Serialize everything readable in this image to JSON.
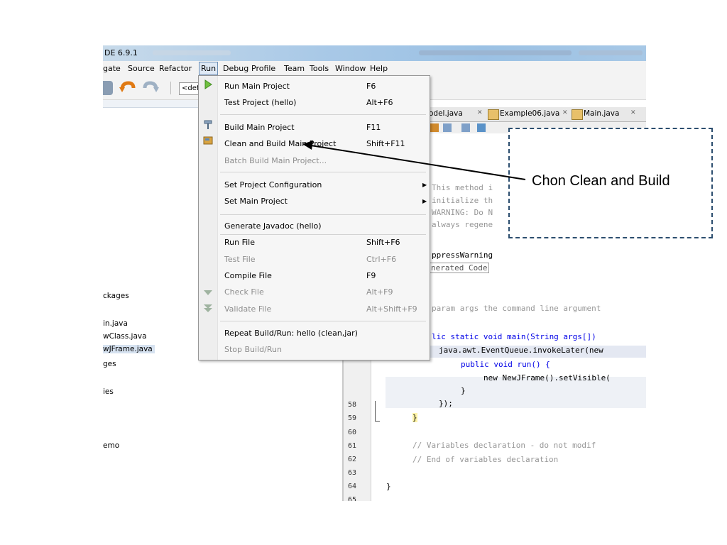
{
  "window": {
    "title": "DE 6.9.1"
  },
  "menubar": {
    "items": [
      "gate",
      "Source",
      "Refactor",
      "Run",
      "Debug",
      "Profile",
      "Team",
      "Tools",
      "Window",
      "Help"
    ]
  },
  "toolbar": {
    "config_combo": "<defa"
  },
  "project_panel": {
    "items": [
      "ckages",
      "in.java",
      "wClass.java",
      "wJFrame.java",
      "ges",
      "ies",
      "emo"
    ]
  },
  "editor": {
    "tabs": [
      "odel.java",
      "Example06.java",
      "Main.java"
    ],
    "line_numbers": [
      "58",
      "59",
      "60",
      "61",
      "62",
      "63",
      "64",
      "65"
    ],
    "code_lines": [
      "This method i",
      "initialize th",
      "WARNING: Do N",
      "always regene",
      "ppressWarning",
      "nerated Code",
      "param args the command line argument",
      "lic static void main(String args[])",
      "java.awt.EventQueue.invokeLater(new",
      "public void run() {",
      "new NewJFrame().setVisible(",
      "}",
      "});",
      "}",
      "// Variables declaration - do not modif",
      "// End of variables declaration",
      "}"
    ]
  },
  "run_menu": {
    "items": [
      {
        "label": "Run Main Project",
        "shortcut": "F6"
      },
      {
        "label": "Test Project (hello)",
        "shortcut": "Alt+F6"
      },
      {
        "label": "Build Main Project",
        "shortcut": "F11"
      },
      {
        "label": "Clean and Build Main Project",
        "shortcut": "Shift+F11"
      },
      {
        "label": "Batch Build Main Project...",
        "shortcut": ""
      },
      {
        "label": "Set Project Configuration",
        "shortcut": ""
      },
      {
        "label": "Set Main Project",
        "shortcut": ""
      },
      {
        "label": "Generate Javadoc (hello)",
        "shortcut": ""
      },
      {
        "label": "Run File",
        "shortcut": "Shift+F6"
      },
      {
        "label": "Test File",
        "shortcut": "Ctrl+F6"
      },
      {
        "label": "Compile File",
        "shortcut": "F9"
      },
      {
        "label": "Check File",
        "shortcut": "Alt+F9"
      },
      {
        "label": "Validate File",
        "shortcut": "Alt+Shift+F9"
      },
      {
        "label": "Repeat Build/Run: hello (clean,jar)",
        "shortcut": ""
      },
      {
        "label": "Stop Build/Run",
        "shortcut": ""
      }
    ]
  },
  "annotation": {
    "text": "Chon Clean and Build"
  },
  "colors": {
    "titlebar": "#a9c9e7",
    "keyword": "#0000e6",
    "comment": "#969696",
    "callout_border": "#2c4e6f"
  }
}
